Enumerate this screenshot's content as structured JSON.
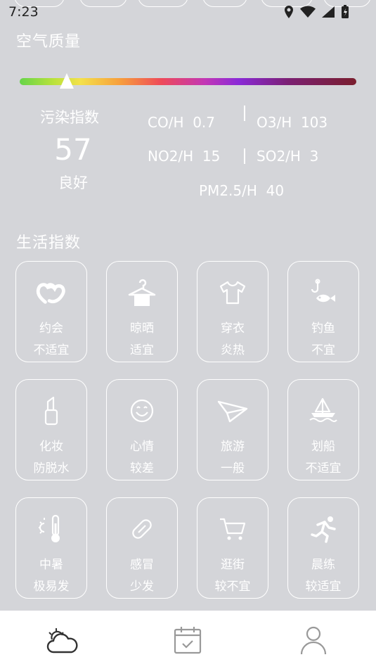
{
  "status": {
    "time": "7:23"
  },
  "air": {
    "title": "空气质量",
    "index_label": "污染指数",
    "index_value": "57",
    "level": "良好",
    "level_fraction": 0.14,
    "pollutants": {
      "co": "CO/H  0.7",
      "o3": "O3/H  103",
      "no2": "NO2/H  15",
      "so2": "SO2/H  3",
      "pm25": "PM2.5/H  40"
    }
  },
  "life": {
    "title": "生活指数",
    "items": [
      {
        "name": "约会",
        "value": "不适宜",
        "icon": "hearts-icon"
      },
      {
        "name": "晾晒",
        "value": "适宜",
        "icon": "hanger-icon"
      },
      {
        "name": "穿衣",
        "value": "炎热",
        "icon": "shirt-icon"
      },
      {
        "name": "钓鱼",
        "value": "不宜",
        "icon": "fishing-icon"
      },
      {
        "name": "化妆",
        "value": "防脱水",
        "icon": "lipstick-icon"
      },
      {
        "name": "心情",
        "value": "较差",
        "icon": "smile-icon"
      },
      {
        "name": "旅游",
        "value": "一般",
        "icon": "paper-plane-icon"
      },
      {
        "name": "划船",
        "value": "不适宜",
        "icon": "boat-icon"
      },
      {
        "name": "中暑",
        "value": "极易发",
        "icon": "thermometer-sun-icon"
      },
      {
        "name": "感冒",
        "value": "少发",
        "icon": "pill-icon"
      },
      {
        "name": "逛街",
        "value": "较不宜",
        "icon": "cart-icon"
      },
      {
        "name": "晨练",
        "value": "较适宜",
        "icon": "runner-icon"
      }
    ]
  },
  "nav": {
    "items": [
      {
        "icon": "weather-cloud-icon"
      },
      {
        "icon": "calendar-check-icon"
      },
      {
        "icon": "user-icon"
      }
    ]
  }
}
